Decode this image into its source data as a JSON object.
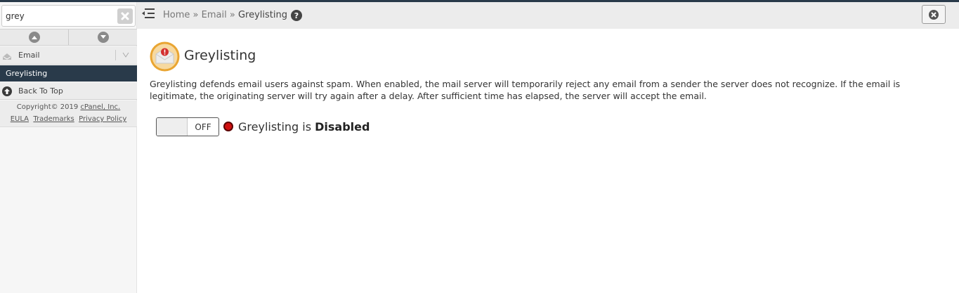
{
  "sidebar": {
    "search": {
      "value": "grey",
      "placeholder": ""
    },
    "group_label": "Email",
    "active_item": "Greylisting",
    "back_to_top": "Back To Top",
    "copyright_prefix": "Copyright© 2019 ",
    "copyright_link": "cPanel, Inc.",
    "footer_links": [
      "EULA",
      "Trademarks",
      "Privacy Policy"
    ]
  },
  "breadcrumb": {
    "items": [
      "Home",
      "Email",
      "Greylisting"
    ],
    "separator": "»",
    "help_glyph": "?"
  },
  "main": {
    "title": "Greylisting",
    "description": "Greylisting defends email users against spam. When enabled, the mail server will temporarily reject any email from a sender the server does not recognize. If the email is legitimate, the originating server will try again after a delay. After sufficient time has elapsed, the server will accept the email.",
    "toggle_label": "OFF",
    "status_prefix": "Greylisting is ",
    "status_value": "Disabled"
  },
  "icons": {
    "clear": "clear-search-icon",
    "up": "arrow-up-icon",
    "down": "arrow-down-icon",
    "group": "email-group-icon",
    "chevron": "chevron-down-icon",
    "back_to_top": "back-to-top-icon",
    "menu": "menu-toggle-icon",
    "help": "help-icon",
    "close": "close-icon",
    "page": "greylisting-envelope-icon",
    "status": "status-dot-icon"
  },
  "colors": {
    "nav_dark": "#293a4a",
    "status_red": "#d01010",
    "icon_orange": "#e9a532"
  }
}
